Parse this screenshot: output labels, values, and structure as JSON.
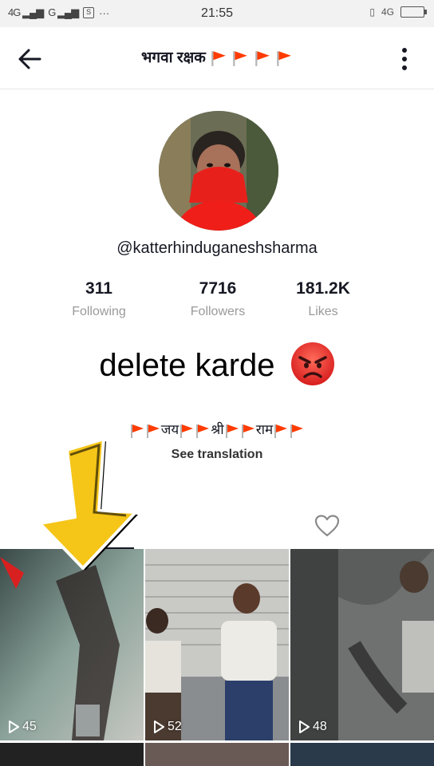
{
  "status_bar": {
    "left": "4G",
    "left2": "G",
    "sim_icon": "S",
    "dots": "···",
    "time": "21:55",
    "network": "4G",
    "icons": [
      "signal-icon",
      "signal-icon",
      "sim-icon",
      "vibrate-icon",
      "battery-icon"
    ]
  },
  "header": {
    "title": "भगवा रक्षक",
    "flags_count": 4,
    "back_icon": "arrow-left-icon",
    "more_icon": "more-vertical-icon"
  },
  "profile": {
    "username": "@katterhinduganeshsharma",
    "stats": [
      {
        "value": "311",
        "label": "Following"
      },
      {
        "value": "7716",
        "label": "Followers"
      },
      {
        "value": "181.2K",
        "label": "Likes"
      }
    ],
    "overlay_caption": "delete karde",
    "bio_parts": [
      "जय",
      "श्री",
      "राम"
    ],
    "see_translation": "See translation"
  },
  "videos": [
    {
      "views": "45"
    },
    {
      "views": "52"
    },
    {
      "views": "48"
    }
  ],
  "colors": {
    "flag": "#ff3b00",
    "accent_arrow": "#f5c518",
    "text": "#161823",
    "muted": "#9a9a9a"
  }
}
